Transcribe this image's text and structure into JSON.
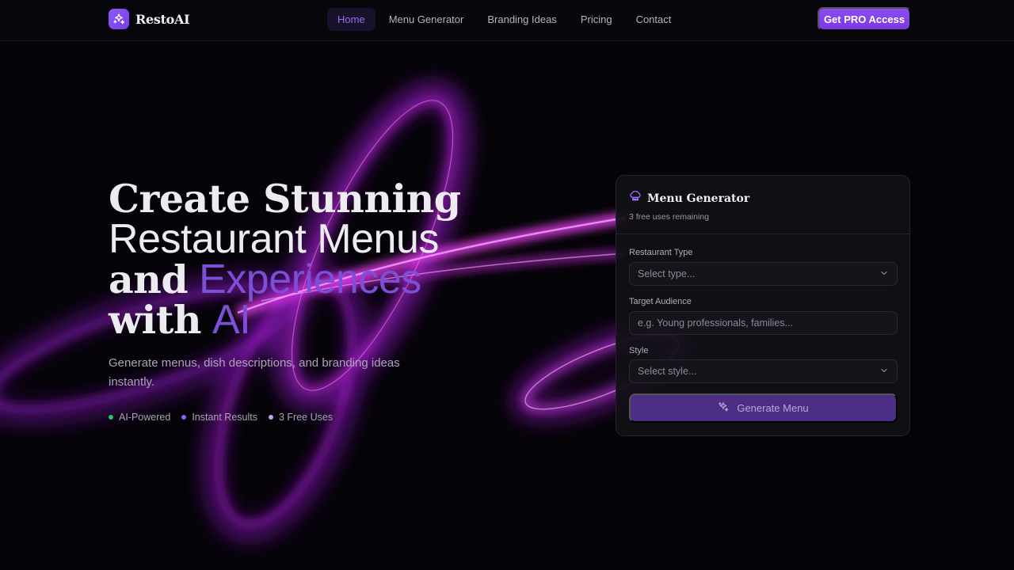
{
  "brand": {
    "name": "RestoAI",
    "icon": "sparkles-icon",
    "accent": "#7c3aed"
  },
  "nav": {
    "items": [
      {
        "label": "Home",
        "active": true
      },
      {
        "label": "Menu Generator",
        "active": false
      },
      {
        "label": "Branding Ideas",
        "active": false
      },
      {
        "label": "Pricing",
        "active": false
      },
      {
        "label": "Contact",
        "active": false
      }
    ],
    "cta": "Get PRO Access"
  },
  "hero": {
    "line1": "Create Stunning",
    "line2": "Restaurant Menus",
    "line3_word": "and",
    "line3_accent": "Experiences",
    "line4_word": "with",
    "line4_accent": "AI",
    "subtitle": "Generate menus, dish descriptions, and branding ideas instantly.",
    "features": [
      {
        "label": "AI-Powered",
        "color": "#22c55e"
      },
      {
        "label": "Instant Results",
        "color": "#8b5cf6"
      },
      {
        "label": "3 Free Uses",
        "color": "#c4a4f7"
      }
    ]
  },
  "card": {
    "icon": "chef-hat-icon",
    "title": "Menu Generator",
    "subtitle": "3 free uses remaining",
    "restaurant_type": {
      "label": "Restaurant Type",
      "value": "Select type..."
    },
    "target_audience": {
      "label": "Target Audience",
      "placeholder": "e.g. Young professionals, families..."
    },
    "style": {
      "label": "Style",
      "value": "Select style..."
    },
    "button": "Generate Menu"
  }
}
